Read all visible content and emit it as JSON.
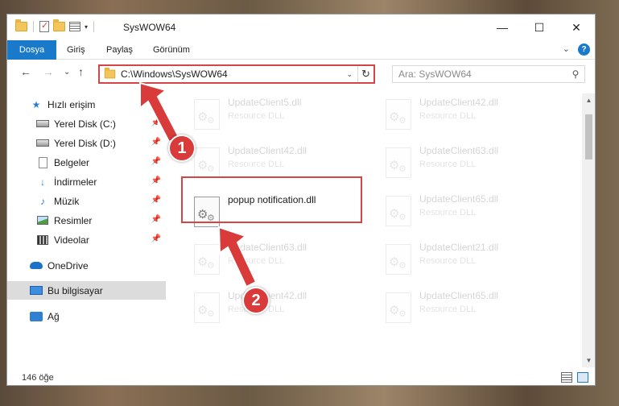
{
  "window": {
    "title": "SysWOW64",
    "controls": {
      "minimize": "—",
      "maximize": "☐",
      "close": "✕"
    }
  },
  "ribbon": {
    "tabs": [
      "Dosya",
      "Giriş",
      "Paylaş",
      "Görünüm"
    ],
    "expand": "⌄",
    "help": "?"
  },
  "navigation": {
    "back": "←",
    "forward": "→",
    "recent": "⌄",
    "up": "↑",
    "address": "C:\\Windows\\SysWOW64",
    "address_dropdown": "⌄",
    "refresh": "↻",
    "search_placeholder": "Ara: SysWOW64",
    "search_icon": "⚲"
  },
  "sidebar": {
    "items": [
      {
        "label": "Hızlı erişim",
        "icon": "star-icon"
      },
      {
        "label": "Yerel Disk (C:)",
        "icon": "drive-icon",
        "pinned": true
      },
      {
        "label": "Yerel Disk (D:)",
        "icon": "drive-icon",
        "pinned": true
      },
      {
        "label": "Belgeler",
        "icon": "documents-icon",
        "pinned": true
      },
      {
        "label": "İndirmeler",
        "icon": "download-icon",
        "pinned": true
      },
      {
        "label": "Müzik",
        "icon": "music-icon",
        "pinned": true
      },
      {
        "label": "Resimler",
        "icon": "pictures-icon",
        "pinned": true
      },
      {
        "label": "Videolar",
        "icon": "videos-icon",
        "pinned": true
      },
      {
        "label": "OneDrive",
        "icon": "cloud-icon"
      },
      {
        "label": "Bu bilgisayar",
        "icon": "computer-icon",
        "selected": true
      },
      {
        "label": "Ağ",
        "icon": "network-icon"
      }
    ],
    "pin_glyph": "📌"
  },
  "files": {
    "left": [
      {
        "name": "UpdateClient5.dll",
        "type": "Resource DLL"
      },
      {
        "name": "UpdateClient42.dll",
        "type": "Resource DLL"
      },
      {
        "name": "popup notification.dll",
        "type": ""
      },
      {
        "name": "UpdateClient63.dll",
        "type": "Resource DLL"
      },
      {
        "name": "UpdateClient42.dll",
        "type": "Resource DLL"
      }
    ],
    "right": [
      {
        "name": "UpdateClient42.dll",
        "type": "Resource DLL"
      },
      {
        "name": "UpdateClient63.dll",
        "type": "Resource DLL"
      },
      {
        "name": "UpdateClient65.dll",
        "type": "Resource DLL"
      },
      {
        "name": "UpdateClient21.dll",
        "type": "Resource DLL"
      },
      {
        "name": "UpdateClient65.dll",
        "type": "Resource DLL"
      }
    ]
  },
  "callouts": [
    "1",
    "2"
  ],
  "scrollbar": {
    "up": "▲",
    "down": "▼"
  },
  "status": {
    "count": "146 öğe"
  },
  "colors": {
    "accent": "#1979ca",
    "highlight": "#d64545",
    "callout": "#d93a3a"
  }
}
